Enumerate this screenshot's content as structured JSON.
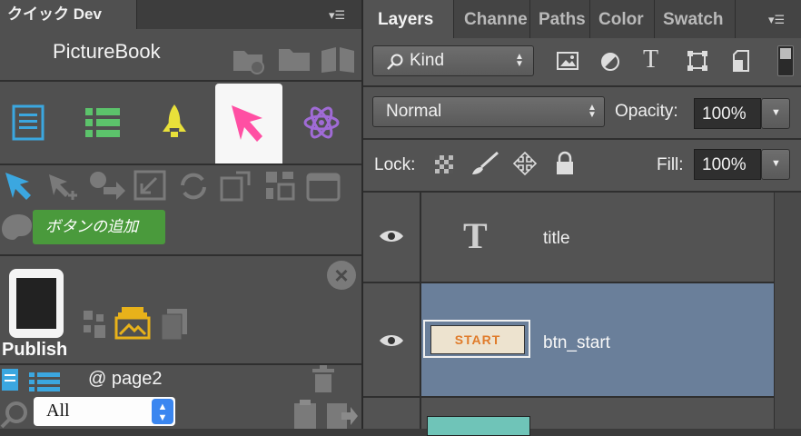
{
  "left_panel": {
    "tab_title": "クイック Dev",
    "app_name": "PictureBook",
    "tooltip": "ボタンの追加",
    "publish_label": "Publish",
    "page_label": "@ page2",
    "filter_value": "All"
  },
  "layers_panel": {
    "tabs": [
      "Layers",
      "Channe",
      "Paths",
      "Color",
      "Swatch"
    ],
    "kind_label": "Kind",
    "blend_mode": "Normal",
    "opacity_label": "Opacity:",
    "opacity_value": "100%",
    "lock_label": "Lock:",
    "fill_label": "Fill:",
    "fill_value": "100%",
    "layers": [
      {
        "name": "title",
        "type": "text",
        "selected": false
      },
      {
        "name": "btn_start",
        "type": "image",
        "thumb_text": "START",
        "selected": true
      }
    ]
  },
  "colors": {
    "selected_row": "#6a7f9a",
    "tooltip_green": "#4a9a3c",
    "icon_blue": "#3ba7e0",
    "icon_green": "#5cc36b",
    "icon_yellow": "#e8e03a",
    "icon_pink": "#ff4fa3",
    "icon_purple": "#a06bd6",
    "start_orange": "#e07b2a"
  }
}
